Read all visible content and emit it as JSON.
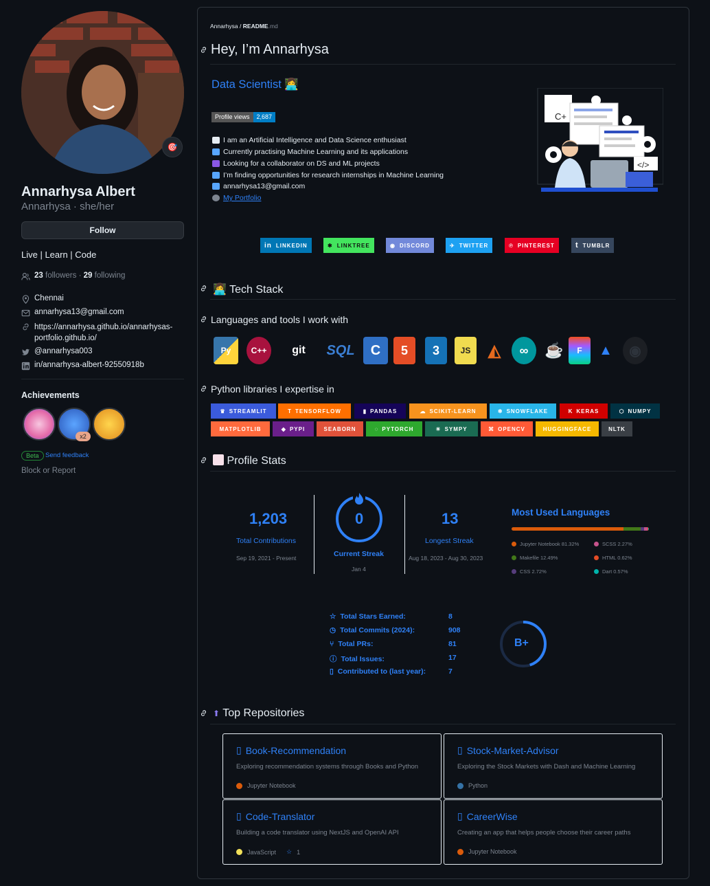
{
  "profile": {
    "full_name": "Annarhysa Albert",
    "login": "Annarhysa",
    "pronouns": "she/her",
    "status_emoji": "🎯",
    "follow_label": "Follow",
    "bio": "Live | Learn | Code",
    "followers_count": "23",
    "followers_label": "followers",
    "following_count": "29",
    "following_label": "following",
    "location": "Chennai",
    "email": "annarhysa13@gmail.com",
    "website_line1": "https://annarhysa.github.io/annarhysas-",
    "website_line2": "portfolio.github.io/",
    "twitter": "@annarhysa003",
    "linkedin": "in/annarhysa-albert-92550918b",
    "achievements_title": "Achievements",
    "achievement_multiplier": "x2",
    "beta_label": "Beta",
    "feedback_label": "Send feedback",
    "block_label": "Block or Report"
  },
  "readme": {
    "path_user": "Annarhysa",
    "path_sep": "/",
    "path_file": "README",
    "path_ext": ".md",
    "title": "Hey, I’m Annarhysa",
    "subtitle": "Data Scientist",
    "views_label": "Profile views",
    "views_count": "2,687",
    "bullets": [
      {
        "text": "I am an Artificial Intelligence and Data Science enthusiast",
        "color": "#e6edf3"
      },
      {
        "text": "Currently practising Machine Learning and its applications",
        "color": "#58a6ff"
      },
      {
        "text": "Looking for a collaborator on DS and ML projects",
        "color": "#8957e5"
      },
      {
        "text": "I’m finding opportunities for research internships in Machine Learning",
        "color": "#58a6ff"
      },
      {
        "text": "annarhysa13@gmail.com",
        "color": "#58a6ff"
      },
      {
        "text": "My Portfolio",
        "color": "#7d8590"
      }
    ],
    "socials": [
      "LINKEDIN",
      "LINKTREE",
      "DISCORD",
      "TWITTER",
      "PINTEREST",
      "TUMBLR"
    ],
    "tech_stack_title": "Tech Stack",
    "languages_title": "Languages and tools I work with",
    "tech_labels": [
      "Py",
      "C++",
      "git",
      "SQL",
      "C",
      "5",
      "3",
      "JS",
      "◭",
      "∞",
      "☕",
      "F",
      "▲",
      "◉"
    ],
    "libraries_title": "Python libraries I expertise in",
    "libraries_row1": [
      "STREAMLIT",
      "TENSORFLOW",
      "PANDAS",
      "SCIKIT-LEARN",
      "SNOWFLAKE",
      "KERAS",
      "NUMPY"
    ],
    "libraries_row2": [
      "MATPLOTLIB",
      "PYPI",
      "SEABORN",
      "PYTORCH",
      "SYMPY",
      "OPENCV",
      "HUGGINGFACE",
      "NLTK"
    ],
    "stats_title": "Profile Stats",
    "streak": {
      "total": "1,203",
      "total_label": "Total Contributions",
      "total_range": "Sep 19, 2021 - Present",
      "current": "0",
      "current_label": "Current Streak",
      "current_date": "Jan 4",
      "longest": "13",
      "longest_label": "Longest Streak",
      "longest_range": "Aug 18, 2023 - Aug 30, 2023"
    },
    "langs_title": "Most Used Languages",
    "languages": [
      {
        "name": "Jupyter Notebook 81.32%",
        "color": "#DA5B0B",
        "pct": 81.32
      },
      {
        "name": "SCSS 2.27%",
        "color": "#c6538c",
        "pct": 2.27
      },
      {
        "name": "Makefile 12.49%",
        "color": "#427819",
        "pct": 12.49
      },
      {
        "name": "HTML 0.62%",
        "color": "#e34c26",
        "pct": 0.62
      },
      {
        "name": "CSS 2.72%",
        "color": "#563d7c",
        "pct": 2.72
      },
      {
        "name": "Dart 0.57%",
        "color": "#00B4AB",
        "pct": 0.57
      }
    ],
    "github_stats": [
      {
        "label": "Total Stars Earned:",
        "value": "8"
      },
      {
        "label": "Total Commits (2024):",
        "value": "908"
      },
      {
        "label": "Total PRs:",
        "value": "81"
      },
      {
        "label": "Total Issues:",
        "value": "17"
      },
      {
        "label": "Contributed to (last year):",
        "value": "7"
      }
    ],
    "grade": "B+",
    "grade_progress": 0.45,
    "repos_title": "Top Repositories",
    "repos": [
      {
        "name": "Book-Recommendation",
        "desc": "Exploring recommendation systems through Books and Python",
        "lang": "Jupyter Notebook",
        "lang_color": "#DA5B0B",
        "stars": ""
      },
      {
        "name": "Stock-Market-Advisor",
        "desc": "Exploring the Stock Markets with Dash and Machine Learning",
        "lang": "Python",
        "lang_color": "#3572A5",
        "stars": ""
      },
      {
        "name": "Code-Translator",
        "desc": "Building a code translator using NextJS and OpenAI API",
        "lang": "JavaScript",
        "lang_color": "#f1e05a",
        "stars": "1"
      },
      {
        "name": "CareerWise",
        "desc": "Creating an app that helps people choose their career paths",
        "lang": "Jupyter Notebook",
        "lang_color": "#DA5B0B",
        "stars": ""
      }
    ]
  },
  "colors": {
    "accent": "#2f81f7",
    "bg": "#0d1117",
    "border": "#30363d"
  }
}
